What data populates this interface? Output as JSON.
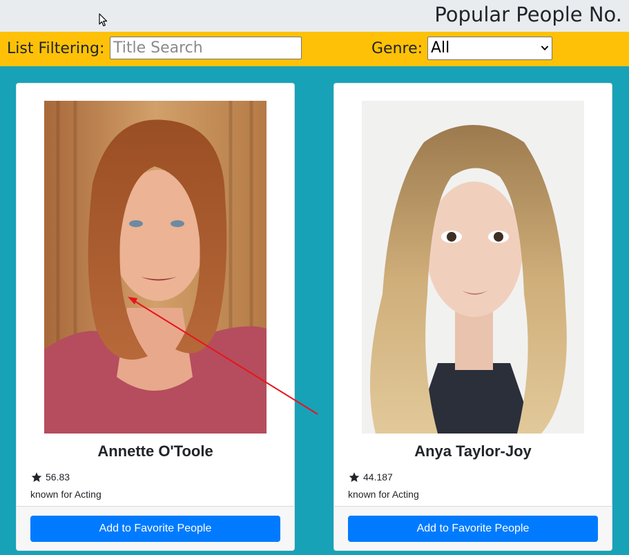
{
  "header": {
    "title": "Popular People No."
  },
  "filters": {
    "list_filtering_label": "List Filtering:",
    "search_placeholder": "Title Search",
    "search_value": "",
    "genre_label": "Genre:",
    "genre_selected": "All"
  },
  "people": [
    {
      "name": "Annette O'Toole",
      "rating": "56.83",
      "known_for": "known for Acting",
      "button_label": "Add to Favorite People"
    },
    {
      "name": "Anya Taylor-Joy",
      "rating": "44.187",
      "known_for": "known for Acting",
      "button_label": "Add to Favorite People"
    }
  ],
  "colors": {
    "header_bg": "#e9ecef",
    "filterbar_bg": "#ffc107",
    "page_bg": "#17a2b8",
    "button_bg": "#007bff",
    "annotation_arrow": "#e8141b"
  },
  "icons": [
    "cursor-icon",
    "chevron-down-icon",
    "star-icon"
  ]
}
